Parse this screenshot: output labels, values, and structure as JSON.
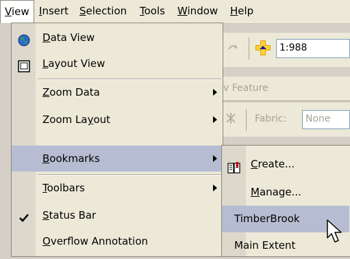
{
  "menubar": {
    "items": [
      {
        "label": "View",
        "mnemonic": "V",
        "rest": "iew"
      },
      {
        "label": "Insert",
        "mnemonic": "I",
        "rest": "nsert"
      },
      {
        "label": "Selection",
        "mnemonic": "S",
        "rest": "election"
      },
      {
        "label": "Tools",
        "mnemonic": "T",
        "rest": "ools"
      },
      {
        "label": "Window",
        "mnemonic": "W",
        "rest": "indow"
      },
      {
        "label": "Help",
        "mnemonic": "H",
        "rest": "elp"
      }
    ]
  },
  "toolbar": {
    "scale_value": "1:988",
    "feature_label": "Feature",
    "feature_prefix": "v",
    "fabric_label": "Fabric:",
    "fabric_value": "None"
  },
  "view_menu": {
    "items": [
      {
        "pre": "",
        "mn": "D",
        "post": "ata View",
        "icon": "globe-icon"
      },
      {
        "pre": "",
        "mn": "L",
        "post": "ayout View",
        "icon": "layout-page-icon"
      },
      {
        "pre": "",
        "mn": "Z",
        "post": "oom Data",
        "submenu": true
      },
      {
        "pre": "Zoom La",
        "mn": "y",
        "post": "out",
        "submenu": true
      },
      {
        "pre": "",
        "mn": "B",
        "post": "ookmarks",
        "submenu": true,
        "highlighted": true
      },
      {
        "pre": "",
        "mn": "T",
        "post": "oolbars",
        "submenu": true
      },
      {
        "pre": "",
        "mn": "S",
        "post": "tatus Bar",
        "checked": true
      },
      {
        "pre": "",
        "mn": "O",
        "post": "verflow Annotation"
      }
    ]
  },
  "bookmarks_menu": {
    "items": [
      {
        "pre": "",
        "mn": "C",
        "post": "reate...",
        "icon": "bookmark-create-icon"
      },
      {
        "pre": "",
        "mn": "M",
        "post": "anage..."
      },
      {
        "label": "TimberBrook",
        "highlighted": true
      },
      {
        "label": "Main Extent"
      }
    ]
  },
  "colors": {
    "menu_bg": "#ece9d8",
    "highlight": "#b6bdd2",
    "separator": "#a9a59a"
  }
}
